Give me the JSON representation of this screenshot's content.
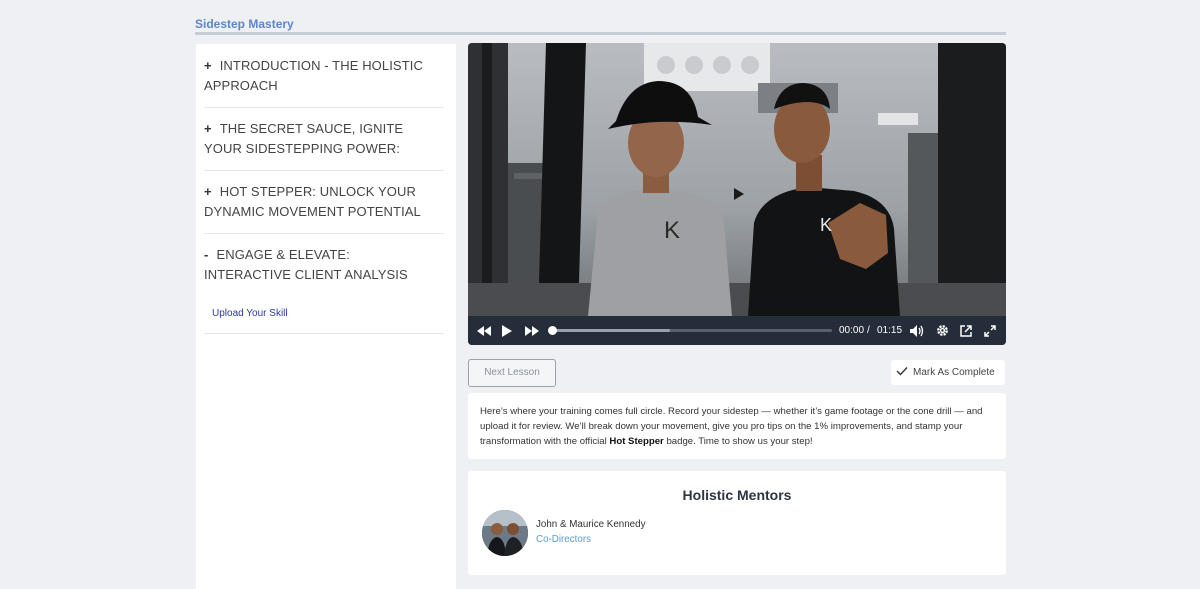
{
  "course": {
    "title": "Sidestep Mastery"
  },
  "sidebar": {
    "sections": [
      {
        "sign": "+",
        "title": "INTRODUCTION - THE HOLISTIC APPROACH"
      },
      {
        "sign": "+",
        "title": "THE SECRET SAUCE, IGNITE YOUR SIDESTEPPING POWER:"
      },
      {
        "sign": "+",
        "title": "HOT STEPPER: UNLOCK YOUR DYNAMIC MOVEMENT POTENTIAL"
      },
      {
        "sign": "-",
        "title": "ENGAGE & ELEVATE: INTERACTIVE CLIENT ANALYSIS"
      }
    ],
    "lessons": [
      {
        "label": "Upload Your Skill"
      }
    ]
  },
  "video": {
    "current_time": "00:00",
    "separator": "/",
    "duration": "01:15",
    "progress": 0,
    "buffered": 0.42,
    "icons": [
      "rewind-icon",
      "play-icon",
      "fast-forward-icon",
      "volume-icon",
      "settings-gear-icon",
      "pip-icon",
      "fullscreen-icon"
    ]
  },
  "actions": {
    "next_label": "Next Lesson",
    "complete_label": "Mark As Complete"
  },
  "description": {
    "part1": "Here’s where your training comes full circle. Record your sidestep — whether it’s game footage or the cone drill — and upload it for review. We’ll break down your movement, give you pro tips on the 1% improvements, and stamp your transformation with the official ",
    "bold": "Hot Stepper",
    "part2": " badge. Time to show us your step!"
  },
  "mentors": {
    "title": "Holistic Mentors",
    "name": "John & Maurice Kennedy",
    "role": "Co-Directors"
  },
  "colors": {
    "accent": "#5b86c9",
    "link": "#2a3a9a",
    "role": "#5b9bd5",
    "controlbar": "#262d3a"
  }
}
